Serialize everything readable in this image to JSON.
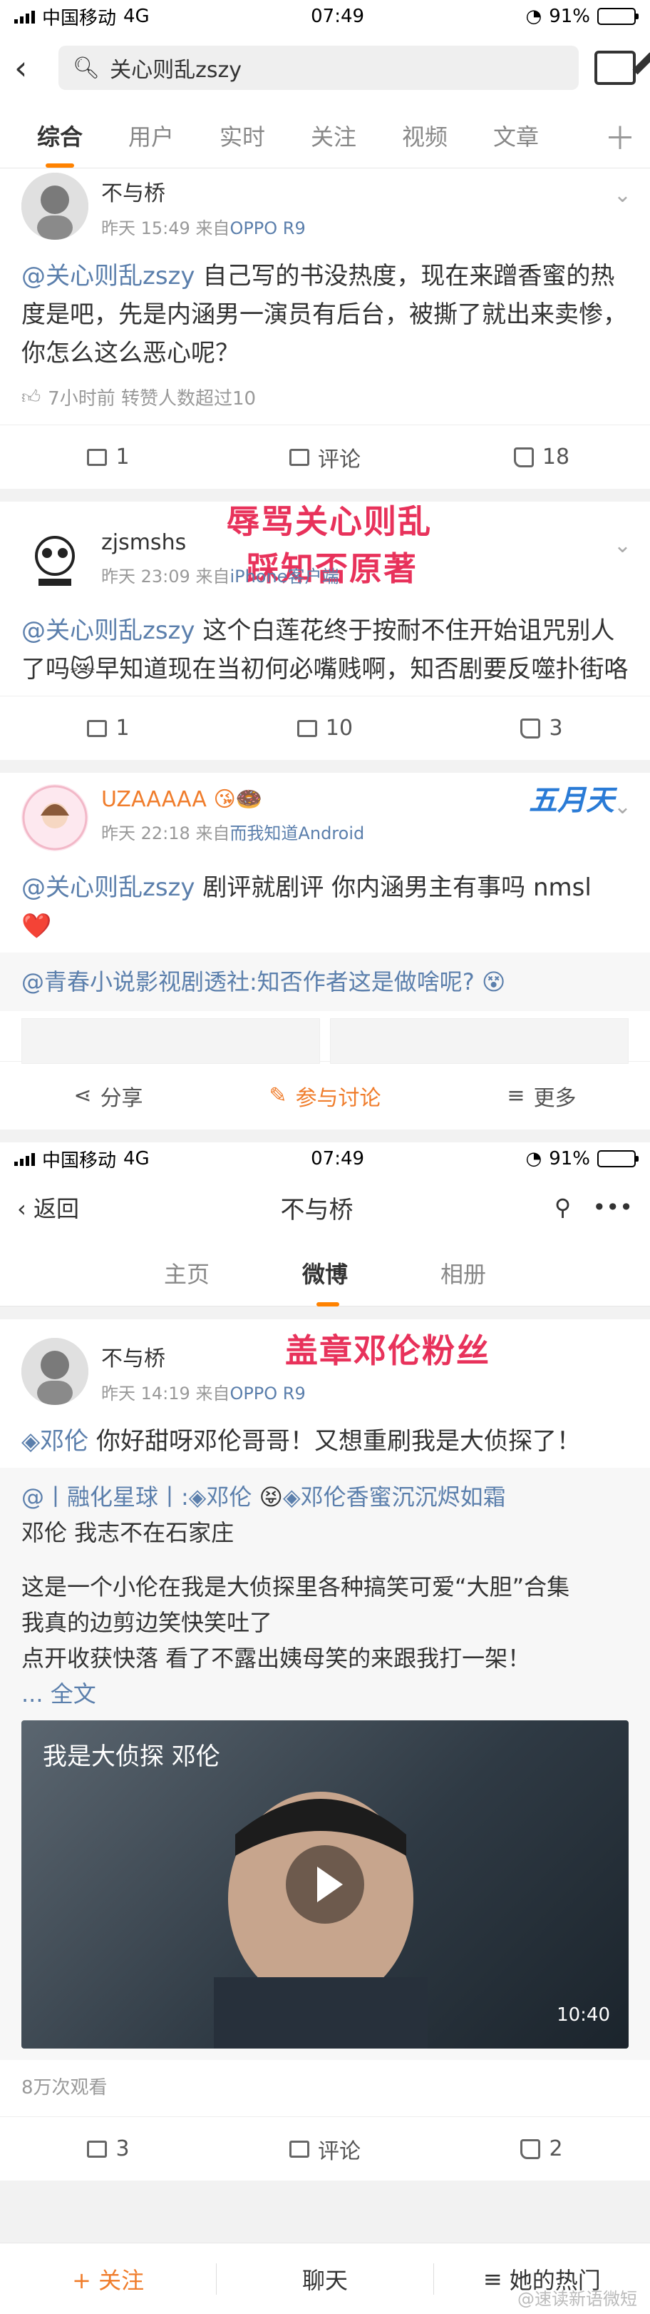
{
  "status1": {
    "carrier": "中国移动",
    "network": "4G",
    "time": "07:49",
    "battery": "91%",
    "battery_fraction": 0.91
  },
  "search": {
    "query": "关心则乱zszy"
  },
  "tabs": [
    "综合",
    "用户",
    "实时",
    "关注",
    "视频",
    "文章"
  ],
  "posts": [
    {
      "user": "不与桥",
      "time": "昨天 15:49",
      "from": "来自",
      "source": "OPPO R9",
      "mention": "@关心则乱zszy",
      "text": " 自己写的书没热度，现在来蹭香蜜的热度是吧，先是内涵男一演员有后台，被撕了就出来卖惨，你怎么这么恶心呢？",
      "sub": "7小时前 转赞人数超过10",
      "reposts": "1",
      "comment": "评论",
      "likes": "18"
    },
    {
      "user": "zjsmshs",
      "time": "昨天 23:09",
      "from": "来自",
      "source": "iPhone客户端",
      "mention": "@关心则乱zszy",
      "text": " 这个白莲花终于按耐不住开始诅咒别人了吗😿早知道现在当初何必嘴贱啊，知否剧要反噬扑街咯",
      "reposts": "1",
      "comments": "10",
      "likes": "3"
    },
    {
      "user": "UZAAAAA",
      "time": "昨天 22:18",
      "from": "来自",
      "source": "而我知道Android",
      "mention": "@关心则乱zszy",
      "text": " 剧评就剧评 你内涵男主有事吗 nmsl ❤️",
      "repost_text": "@青春小说影视剧透社:知否作者这是做啥呢? 😵",
      "share": "分享",
      "discuss": "参与讨论",
      "more": "更多"
    }
  ],
  "annotations": {
    "a1": "辱骂关心则乱",
    "a2": "踩知否原著",
    "a3": "盖章邓伦粉丝",
    "sticker": "五月天"
  },
  "status2": {
    "carrier": "中国移动",
    "network": "4G",
    "time": "07:49",
    "battery": "91%"
  },
  "profile": {
    "back": "返回",
    "title": "不与桥",
    "tabs": [
      "主页",
      "微博",
      "相册"
    ]
  },
  "post4": {
    "user": "不与桥",
    "time": "昨天 14:19",
    "from": "来自",
    "source": "OPPO R9",
    "tag": "邓伦",
    "text": " 你好甜呀邓伦哥哥！又想重刷我是大侦探了！",
    "quote1": "@丨融化星球丨:",
    "quote_tag1": "邓伦",
    "quote_tag2": "邓伦香蜜沉沉烬如霜",
    "quote2": "邓伦 我志不在石家庄",
    "quote3": "这是一个小伦在我是大侦探里各种搞笑可爱“大胆”合集",
    "quote4": "我真的边剪边笑快笑吐了",
    "quote5": "点开收获快落 看了不露出姨母笑的来跟我打一架！",
    "expand": "... 全文",
    "video_title": "我是大侦探 邓伦",
    "video_duration": "10:40",
    "views": "8万次观看",
    "reposts": "3",
    "comment": "评论",
    "likes": "2"
  },
  "bottom": {
    "follow": "+ 关注",
    "chat": "聊天",
    "hot": "她的热门"
  },
  "watermark": "@速读新语微短"
}
